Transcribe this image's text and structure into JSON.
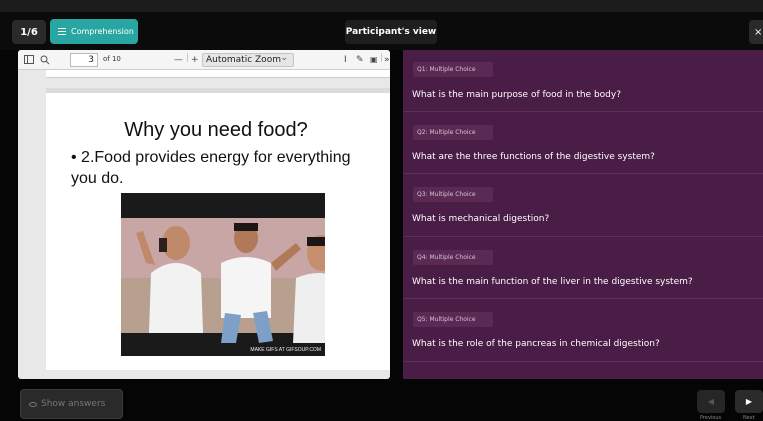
{
  "topbar": {
    "page_counter": "1/6",
    "mode_button": "Comprehension",
    "view_label": "Participant's view",
    "close": "×"
  },
  "pdf_viewer": {
    "toolbar": {
      "sidebar_icon": "sidebar-toggle-icon",
      "search_icon": "search-icon",
      "current_page": "3",
      "page_count": "of 10",
      "zoom_out": "—",
      "zoom_in": "+",
      "zoom_value": "Automatic Zoom",
      "chevron": "⌄",
      "text_tool": "I",
      "draw_tool": "✎",
      "image_tool": "▣",
      "more": "»"
    },
    "slide": {
      "title": "Why you need food?",
      "bullet": "• 2.Food provides energy for everything you do.",
      "gif_caption": "MAKE GIFS AT GIFSOUP.COM"
    }
  },
  "questions": [
    {
      "tag": "Q1: Multiple Choice",
      "text": "What is the main purpose of food in the body?"
    },
    {
      "tag": "Q2: Multiple Choice",
      "text": "What are the three functions of the digestive system?"
    },
    {
      "tag": "Q3: Multiple Choice",
      "text": "What is mechanical digestion?"
    },
    {
      "tag": "Q4: Multiple Choice",
      "text": "What is the main function of the liver in the digestive system?"
    },
    {
      "tag": "Q5: Multiple Choice",
      "text": "What is the role of the pancreas in chemical digestion?"
    }
  ],
  "bottombar": {
    "show_answers": "Show answers",
    "previous_icon": "◀",
    "next_icon": "▶",
    "previous_label": "Previous",
    "next_label": "Next"
  },
  "colors": {
    "accent": "#2aa6a2",
    "question_panel": "#4a1d46"
  }
}
